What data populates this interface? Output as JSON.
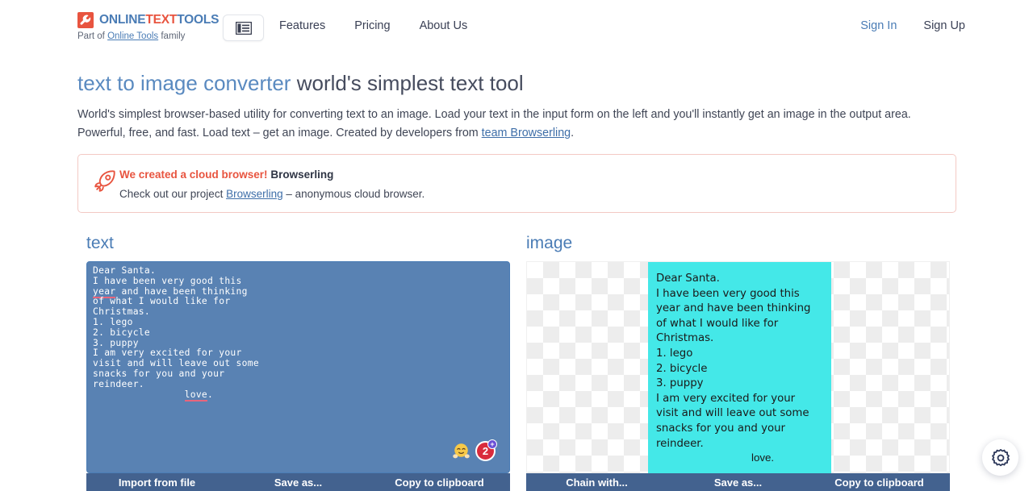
{
  "header": {
    "logo": {
      "part1": "ONLINE",
      "part2": "TEXT",
      "part3": "TOOLS"
    },
    "tagline_pre": "Part of ",
    "tagline_link": "Online Tools",
    "tagline_post": " family",
    "nav": [
      {
        "label": "Features"
      },
      {
        "label": "Pricing"
      },
      {
        "label": "About Us"
      }
    ],
    "auth": {
      "sign_in": "Sign In",
      "sign_up": "Sign Up"
    }
  },
  "page": {
    "title_primary": "text to image converter",
    "title_secondary": "world's simplest text tool",
    "description_pre": "World's simplest browser-based utility for converting text to an image. Load your text in the input form on the left and you'll instantly get an image in the output area. Powerful, free, and fast. Load text – get an image. Created by developers from ",
    "description_link": "team Browserling",
    "description_post": "."
  },
  "promo": {
    "icon": "rocket-icon",
    "headline_highlight": "We created a cloud browser!",
    "headline_name": "Browserling",
    "sub_pre": "Check out our project ",
    "sub_link": "Browserling",
    "sub_post": " – anonymous cloud browser."
  },
  "tool": {
    "input": {
      "heading": "text",
      "value": "Dear Santa.\nI have been very good this\nyear and have been thinking\nof what I would like for\nChristmas.\n1. lego\n2. bicycle\n3. puppy\nI am very excited for your\nvisit and will leave out some\nsnacks for you and your\nreindeer.\n                love.",
      "misspelled": [
        "year",
        "love"
      ],
      "badge_count": "2",
      "toolbar": {
        "import": "Import from file",
        "save": "Save as...",
        "copy": "Copy to clipboard"
      }
    },
    "output": {
      "heading": "image",
      "rendered_text": "Dear Santa.\nI have been very good this\nyear and have been thinking\nof what I would like for\nChristmas.\n1. lego\n2. bicycle\n3. puppy\nI am very excited for your\nvisit and will leave out some\nsnacks for you and your\nreindeer.",
      "rendered_signature": "love.",
      "background_color": "#44e8e8",
      "toolbar": {
        "chain": "Chain with...",
        "save": "Save as...",
        "copy": "Copy to clipboard"
      }
    }
  },
  "fab": {
    "icon": "gear-icon"
  },
  "colors": {
    "brand_blue": "#4a7cb5",
    "brand_red": "#e8543f",
    "editor_bg": "#5982b3",
    "toolbar_bg": "#43628f",
    "image_bg": "#44e8e8"
  }
}
